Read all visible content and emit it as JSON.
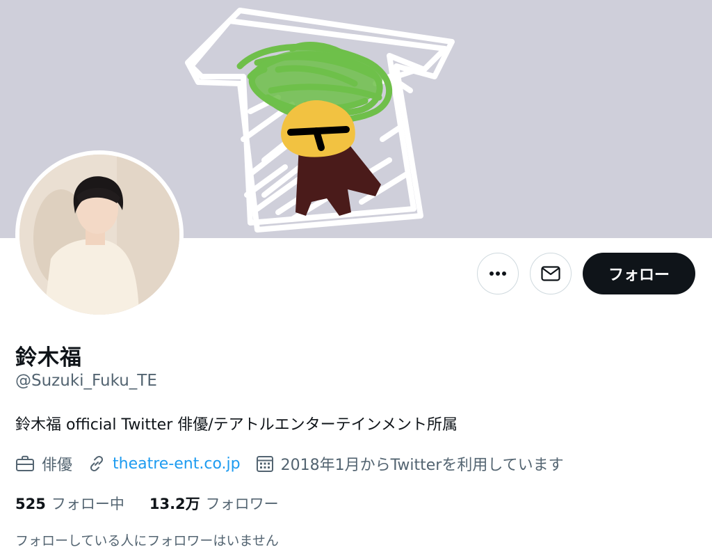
{
  "profile": {
    "name": "鈴木福",
    "handle": "@Suzuki_Fuku_TE",
    "bio": "鈴木福 official Twitter 俳優/テアトルエンターテインメント所属",
    "occupation": "俳優",
    "website": "theatre-ent.co.jp",
    "joined": "2018年1月からTwitterを利用しています"
  },
  "actions": {
    "follow_label": "フォロー",
    "more_icon": "more-horizontal-icon",
    "message_icon": "envelope-icon"
  },
  "stats": {
    "following_count": "525",
    "following_label": "フォロー中",
    "followers_count": "13.2万",
    "followers_label": "フォロワー"
  },
  "followers_note": "フォローしている人にフォロワーはいません",
  "colors": {
    "banner": "#cfcfda",
    "link": "#1d9bf0",
    "follow_button": "#0f1419",
    "muted_text": "#536471"
  }
}
